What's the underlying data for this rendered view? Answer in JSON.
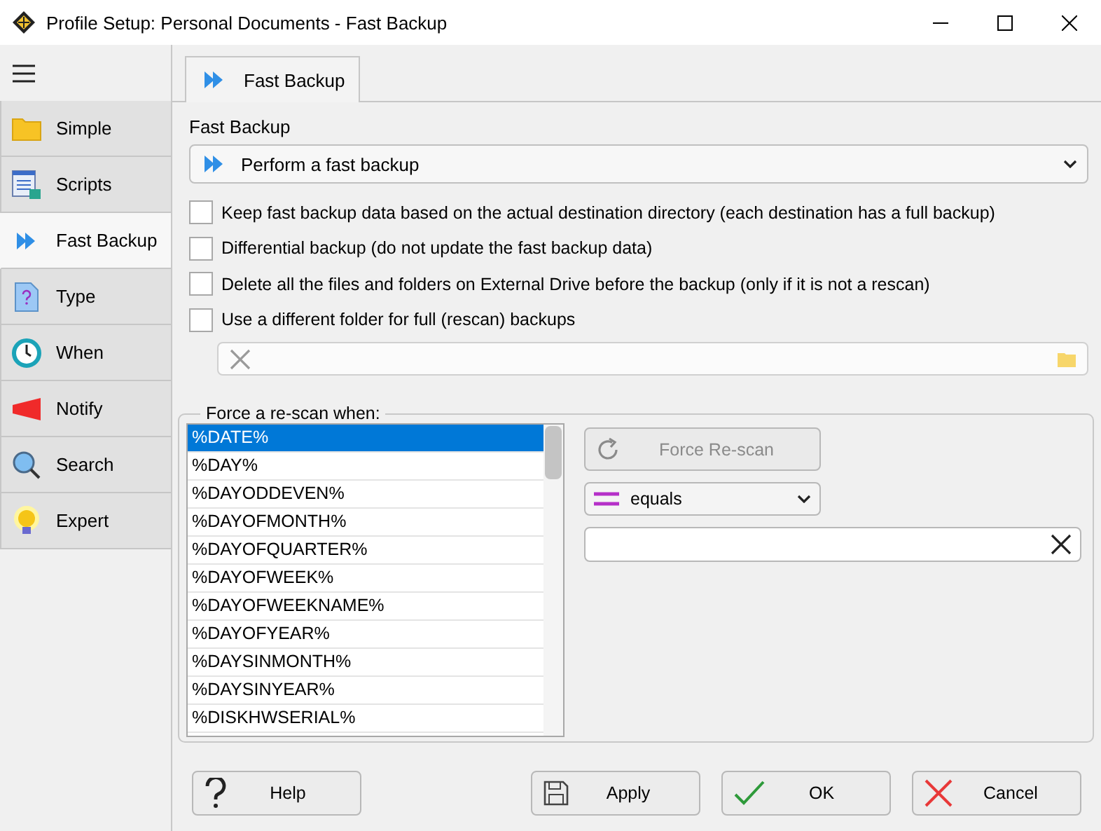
{
  "window": {
    "title": "Profile Setup: Personal Documents - Fast Backup"
  },
  "sidebar": {
    "items": [
      {
        "label": "Simple",
        "selected": false
      },
      {
        "label": "Scripts",
        "selected": false
      },
      {
        "label": "Fast Backup",
        "selected": true
      },
      {
        "label": "Type",
        "selected": false
      },
      {
        "label": "When",
        "selected": false
      },
      {
        "label": "Notify",
        "selected": false
      },
      {
        "label": "Search",
        "selected": false
      },
      {
        "label": "Expert",
        "selected": false
      }
    ]
  },
  "tabs": [
    {
      "label": "Fast Backup",
      "selected": true
    }
  ],
  "fast_backup": {
    "label": "Fast Backup",
    "mode": "Perform a fast backup"
  },
  "options": [
    {
      "label": "Keep fast backup data based on the actual destination directory (each destination has a full backup)",
      "checked": false
    },
    {
      "label": "Differential backup (do not update the fast backup data)",
      "checked": false
    },
    {
      "label": "Delete all the files and folders on External Drive before the backup (only if it is not a rescan)",
      "checked": false
    },
    {
      "label": "Use a different folder for full (rescan) backups",
      "checked": false
    }
  ],
  "rescan": {
    "title": "Force a re-scan when:",
    "variables": [
      {
        "label": "%DATE%",
        "selected": true
      },
      {
        "label": "%DAY%",
        "selected": false
      },
      {
        "label": "%DAYODDEVEN%",
        "selected": false
      },
      {
        "label": "%DAYOFMONTH%",
        "selected": false
      },
      {
        "label": "%DAYOFQUARTER%",
        "selected": false
      },
      {
        "label": "%DAYOFWEEK%",
        "selected": false
      },
      {
        "label": "%DAYOFWEEKNAME%",
        "selected": false
      },
      {
        "label": "%DAYOFYEAR%",
        "selected": false
      },
      {
        "label": "%DAYSINMONTH%",
        "selected": false
      },
      {
        "label": "%DAYSINYEAR%",
        "selected": false
      },
      {
        "label": "%DISKHWSERIAL%",
        "selected": false
      }
    ],
    "button": {
      "label": "Force Re-scan",
      "disabled": true
    },
    "operator": "equals"
  },
  "buttons": [
    {
      "label": "Help",
      "kind": "help"
    },
    {
      "label": "Apply",
      "kind": "apply"
    },
    {
      "label": "OK",
      "kind": "ok"
    },
    {
      "label": "Cancel",
      "kind": "cancel"
    }
  ]
}
